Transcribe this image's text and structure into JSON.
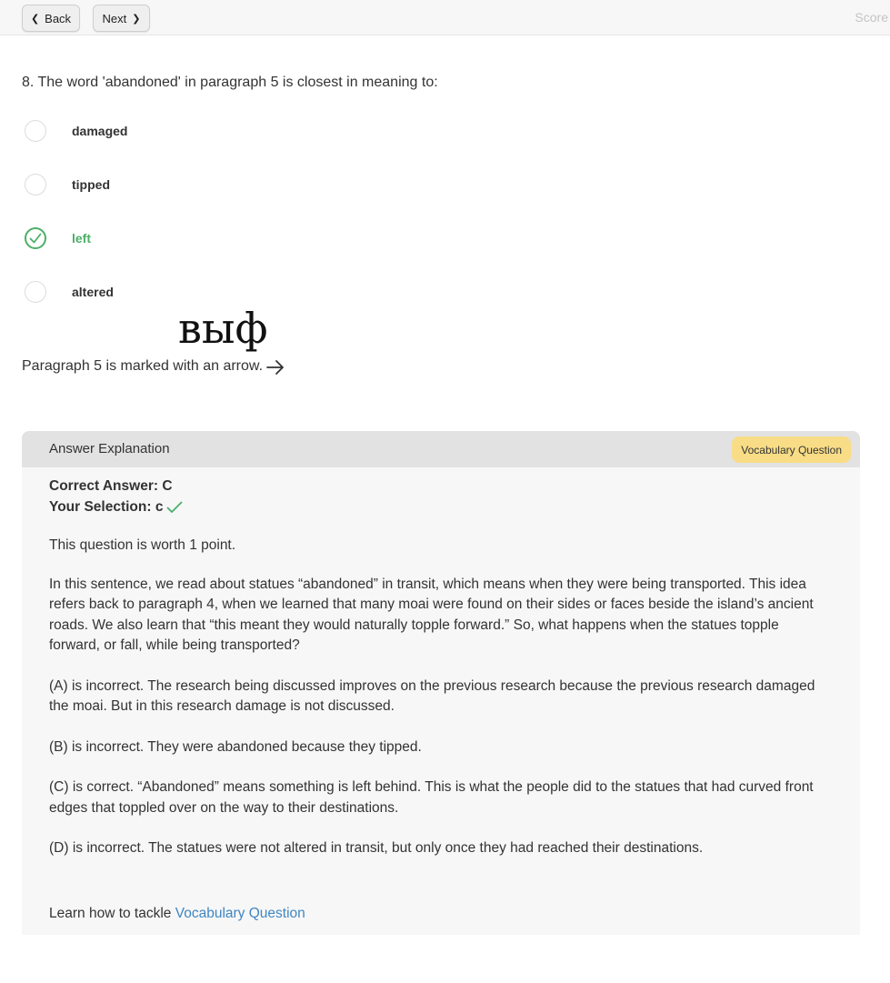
{
  "topbar": {
    "back_label": "Back",
    "next_label": "Next",
    "score_label": "Score"
  },
  "question": {
    "text": "8. The word 'abandoned' in paragraph 5 is closest in meaning to:",
    "options": [
      {
        "label": "damaged",
        "state": "unselected"
      },
      {
        "label": "tipped",
        "state": "unselected"
      },
      {
        "label": "left",
        "state": "selected-correct"
      },
      {
        "label": "altered",
        "state": "unselected"
      }
    ]
  },
  "overlay_text": "выф",
  "paragraph_note": "Paragraph 5 is marked with an arrow.",
  "explanation": {
    "title": "Answer Explanation",
    "badge": "Vocabulary Question",
    "correct_answer": "Correct Answer: C",
    "your_selection": "Your Selection: c",
    "worth": "This question is worth 1 point.",
    "paragraphs": [
      "In this sentence, we read about statues “abandoned” in transit, which means when they were being transported. This idea refers back to paragraph 4, when we learned that many moai were found on their sides or faces beside the island’s ancient roads. We also learn that “this meant they would naturally topple forward.” So, what happens when the statues topple forward, or fall, while being transported?",
      "(A) is incorrect. The research being discussed improves on the previous research because the previous research damaged the moai. But in this research damage is not discussed.",
      "(B) is incorrect. They were abandoned because they tipped.",
      "(C) is correct. “Abandoned” means something is left behind. This is what the people did to the statues that had curved front edges that toppled over on the way to their destinations.",
      "(D) is incorrect. The statues were not altered in transit, but only once they had reached their destinations."
    ],
    "learn_prefix": "Learn how to tackle",
    "learn_link": "Vocabulary Question"
  },
  "colors": {
    "correct_green": "#4caf68",
    "badge_yellow": "#f8dd86",
    "link_blue": "#3f86c3",
    "header_gray": "#e2e2e2"
  }
}
